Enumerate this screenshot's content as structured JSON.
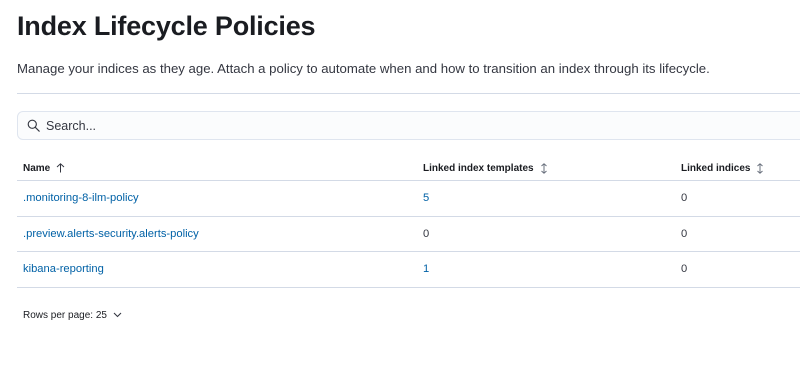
{
  "page": {
    "title": "Index Lifecycle Policies",
    "description": "Manage your indices as they age. Attach a policy to automate when and how to transition an index through its lifecycle."
  },
  "search": {
    "placeholder": "Search...",
    "icon": "search-icon"
  },
  "table": {
    "columns": [
      {
        "label": "Name",
        "sort_icon": "arrow-up-icon"
      },
      {
        "label": "Linked index templates",
        "sort_icon": "sortable-icon"
      },
      {
        "label": "Linked indices",
        "sort_icon": "sortable-icon"
      }
    ],
    "rows": [
      {
        "name": ".monitoring-8-ilm-policy",
        "templates": "5",
        "indices": "0"
      },
      {
        "name": ".preview.alerts-security.alerts-policy",
        "templates": "0",
        "indices": "0"
      },
      {
        "name": "kibana-reporting",
        "templates": "1",
        "indices": "0"
      }
    ]
  },
  "pagination": {
    "rows_per_page": "Rows per page: 25"
  },
  "colors": {
    "link": "#0061a6",
    "border": "#d3dae6",
    "text": "#1a1c21"
  }
}
